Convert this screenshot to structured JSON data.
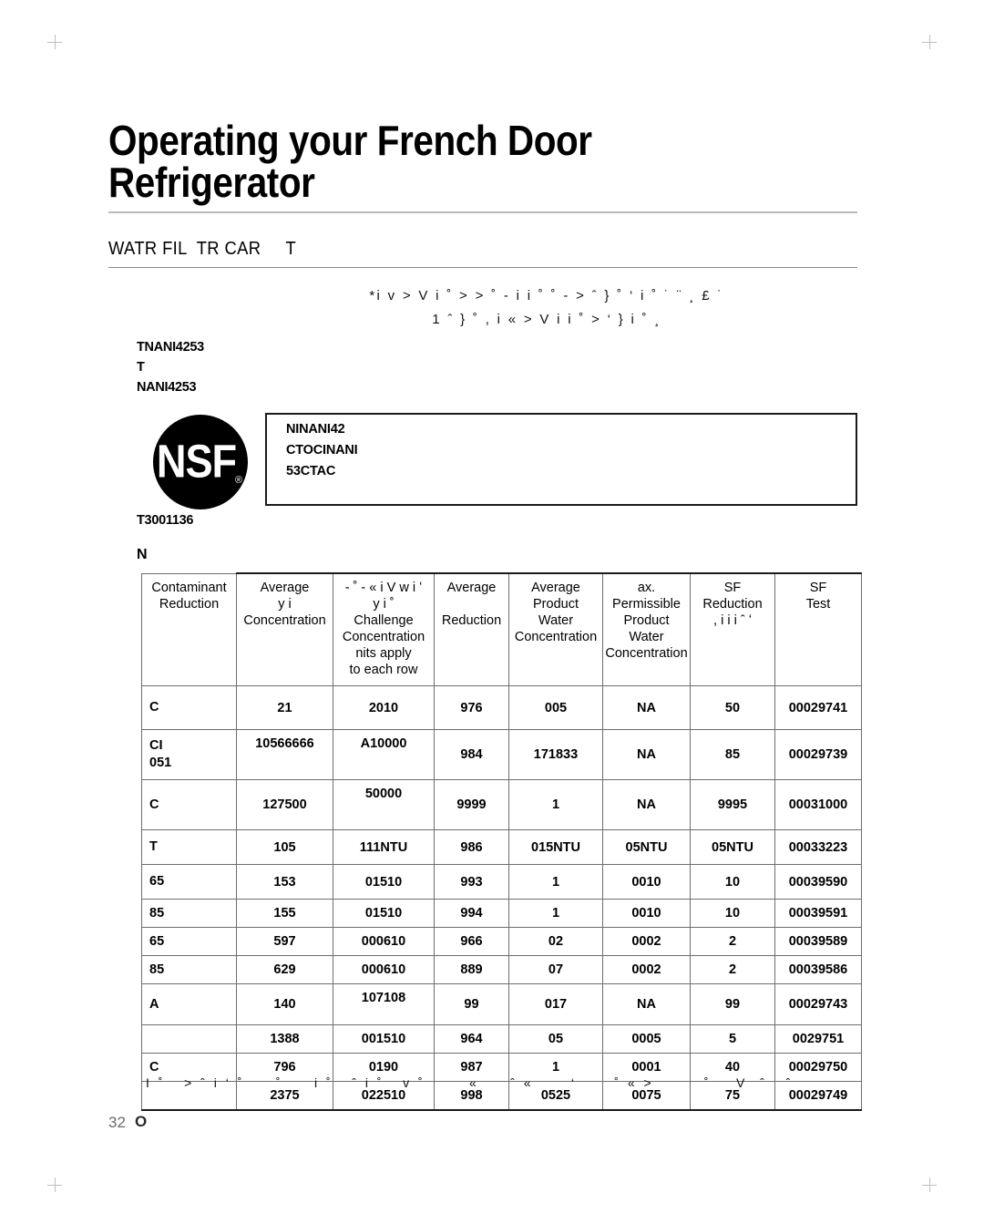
{
  "document": {
    "title": "Operating your French Door\nRefrigerator",
    "section_heading": "WATR FIL  TR CAR     T",
    "intro_paragraph": "*i  v    >  V i ˚  >  > ˚ -  i i  ˚     ˚ - >   ˆ    } ˚    ‘ i ˚      ˙    ¨ ¸ £ ˙\n1 ˆ    } ˚ , i «   > V i   i     ˚   >        ‘ } i ˚                      ¸",
    "model_codes": "TNANI4253\nT\nNANI4253",
    "certification_box": "NINANI42\nCTOCINANI\n53CTAC",
    "nsf_logo": {
      "mark": "NSF",
      "registered": "®"
    },
    "part_code": "T3001136",
    "table_caption": "N",
    "footer_note": "I ˚   > ˆ i ‘ ˚     ˚     i ˚   ˆ i ˚   v ˚       «     ˆ «      ‘      ˚ « >        ˚    V  ˆ   ˆ",
    "page_number": "32",
    "page_mark": "O"
  },
  "table": {
    "columns": [
      "Contaminant\nReduction",
      "Average\ny  i\nConcentration",
      "-   ˚ - « i V   w i ʻ\ny  i     ˚\nChallenge\nConcentration\nnits apply\nto each row",
      "Average\n\nReduction",
      "Average\nProduct\nWater\nConcentration",
      "ax.\nPermissible\nProduct\nWater\nConcentration",
      "SF\nReduction\n, i      i  i     ˆ ʻ",
      "SF\nTest"
    ],
    "rows": [
      {
        "h": "tall",
        "cells": [
          "C",
          "21",
          "2010",
          "976",
          "005",
          "NA",
          "50",
          "00029741"
        ]
      },
      {
        "h": "tall",
        "cells": [
          "CI\n051",
          "10566666",
          "A10000",
          "984",
          "171833",
          "NA",
          "85",
          "00029739"
        ]
      },
      {
        "h": "tall",
        "cells": [
          "C",
          "127500",
          "50000",
          "9999",
          "1",
          "NA",
          "9995",
          "00031000"
        ]
      },
      {
        "h": "mid",
        "cells": [
          "T",
          "105",
          "111NTU",
          "986",
          "015NTU",
          "05NTU",
          "05NTU",
          "00033223"
        ]
      },
      {
        "h": "mid",
        "cells": [
          "65",
          "153",
          "01510",
          "993",
          "1",
          "0010",
          "10",
          "00039590"
        ]
      },
      {
        "h": "short",
        "cells": [
          "85",
          "155",
          "01510",
          "994",
          "1",
          "0010",
          "10",
          "00039591"
        ]
      },
      {
        "h": "short",
        "cells": [
          "65",
          "597",
          "000610",
          "966",
          "02",
          "0002",
          "2",
          "00039589"
        ]
      },
      {
        "h": "short",
        "cells": [
          "85",
          "629",
          "000610",
          "889",
          "07",
          "0002",
          "2",
          "00039586"
        ]
      },
      {
        "h": "mid",
        "cells": [
          "A",
          "140",
          "107108",
          "99",
          "017",
          "NA",
          "99",
          "00029743"
        ]
      },
      {
        "h": "short",
        "cells": [
          "",
          "1388",
          "001510",
          "964",
          "05",
          "0005",
          "5",
          "0029751"
        ]
      },
      {
        "h": "short",
        "cells": [
          "C",
          "796",
          "0190",
          "987",
          "1",
          "0001",
          "40",
          "00029750"
        ]
      },
      {
        "h": "short",
        "cells": [
          "",
          "2375",
          "022510",
          "998",
          "0525",
          "0075",
          "75",
          "00029749"
        ]
      }
    ]
  }
}
